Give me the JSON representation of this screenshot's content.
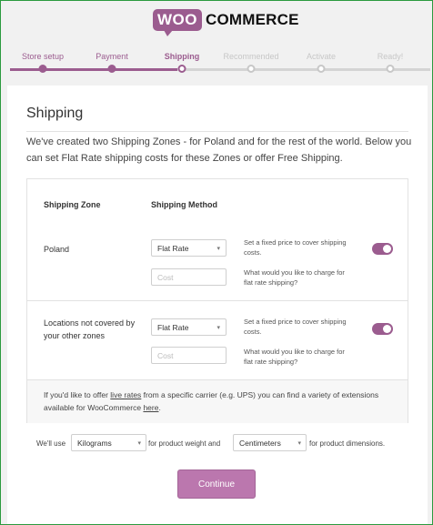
{
  "brand": {
    "woo": "WOO",
    "commerce": "COMMERCE",
    "accent": "#9b5c8f"
  },
  "steps": [
    {
      "label": "Store setup",
      "state": "done"
    },
    {
      "label": "Payment",
      "state": "done"
    },
    {
      "label": "Shipping",
      "state": "active"
    },
    {
      "label": "Recommended",
      "state": "todo"
    },
    {
      "label": "Activate",
      "state": "todo"
    },
    {
      "label": "Ready!",
      "state": "todo"
    }
  ],
  "card": {
    "title": "Shipping",
    "intro": "We've created two Shipping Zones - for Poland and for the rest of the world. Below you can set Flat Rate shipping costs for these Zones or offer Free Shipping."
  },
  "table": {
    "col_zone": "Shipping Zone",
    "col_method": "Shipping Method",
    "rows": [
      {
        "zone": "Poland",
        "method": "Flat Rate",
        "cost_placeholder": "Cost",
        "desc_method": "Set a fixed price to cover shipping costs.",
        "desc_cost": "What would you like to charge for flat rate shipping?",
        "enabled": true
      },
      {
        "zone": "Locations not covered by your other zones",
        "method": "Flat Rate",
        "cost_placeholder": "Cost",
        "desc_method": "Set a fixed price to cover shipping costs.",
        "desc_cost": "What would you like to charge for flat rate shipping?",
        "enabled": true
      }
    ],
    "footer": {
      "before": "If you'd like to offer ",
      "link1": "live rates",
      "middle": " from a specific carrier (e.g. UPS) you can find a variety of extensions available for WooCommerce ",
      "link2": "here",
      "after": "."
    }
  },
  "units": {
    "prefix": "We'll use",
    "weight": "Kilograms",
    "weight_suffix": "for product weight and",
    "dimension": "Centimeters",
    "dimension_suffix": "for product dimensions."
  },
  "continue_label": "Continue",
  "caret_icon": "▾"
}
